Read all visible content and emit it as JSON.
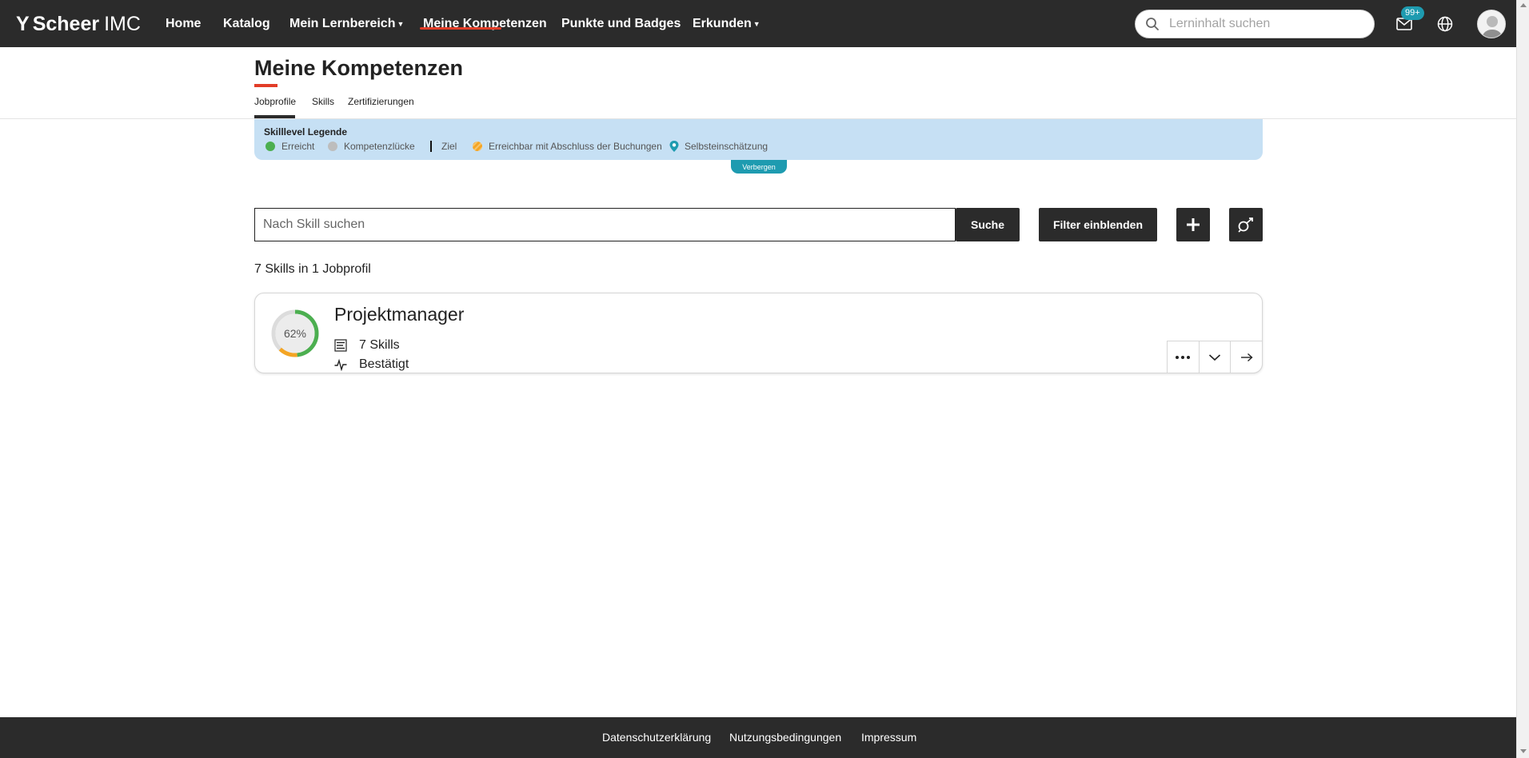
{
  "brand": {
    "mark": "Y",
    "name_bold": "Scheer",
    "name_light": "IMC"
  },
  "nav": {
    "items": [
      {
        "label": "Home"
      },
      {
        "label": "Katalog"
      },
      {
        "label": "Mein Lernbereich",
        "dropdown": true
      },
      {
        "label": "Meine Kompetenzen",
        "active": true
      },
      {
        "label": "Punkte und Badges"
      },
      {
        "label": "Erkunden",
        "dropdown": true
      }
    ],
    "search_placeholder": "Lerninhalt suchen",
    "notifications_badge": "99+",
    "icons": [
      "search-icon",
      "mail-icon",
      "globe-icon",
      "avatar"
    ]
  },
  "page": {
    "title": "Meine Kompetenzen",
    "tabs": [
      {
        "label": "Jobprofile",
        "active": true
      },
      {
        "label": "Skills"
      },
      {
        "label": "Zertifizierungen"
      }
    ]
  },
  "legend": {
    "title": "Skilllevel Legende",
    "items": [
      {
        "label": "Erreicht",
        "marker": "dot",
        "color": "#4caf50"
      },
      {
        "label": "Kompetenzlücke",
        "marker": "dot",
        "color": "#bdbdbd"
      },
      {
        "label": "Ziel",
        "marker": "bar",
        "color": "#111111"
      },
      {
        "label": "Erreichbar mit Abschluss der Buchungen",
        "marker": "dot-striped",
        "color": "#f4a524"
      },
      {
        "label": "Selbsteinschätzung",
        "marker": "pin",
        "color": "#1e9bb0"
      }
    ],
    "hide_label": "Verbergen"
  },
  "skill_search": {
    "placeholder": "Nach Skill suchen",
    "search_button": "Suche",
    "filter_button": "Filter einblenden",
    "add_icon": "plus-icon",
    "assess_icon": "self-assessment-icon"
  },
  "results_text": "7 Skills in 1 Jobprofil",
  "job_profiles": [
    {
      "title": "Projektmanager",
      "progress_label": "62%",
      "progress": 0.62,
      "skills_label": "7 Skills",
      "status": "Bestätigt",
      "actions": [
        "more-icon",
        "chevron-down-icon",
        "arrow-right-icon"
      ]
    }
  ],
  "footer": {
    "links": [
      "Datenschutzerklärung",
      "Nutzungsbedingungen",
      "Impressum"
    ]
  },
  "colors": {
    "header_bg": "#2b2b2b",
    "accent_red": "#e23d28",
    "teal": "#1e9bb0",
    "legend_bg": "#c6e0f4",
    "progress_green": "#4caf50",
    "progress_orange": "#f4a524"
  }
}
